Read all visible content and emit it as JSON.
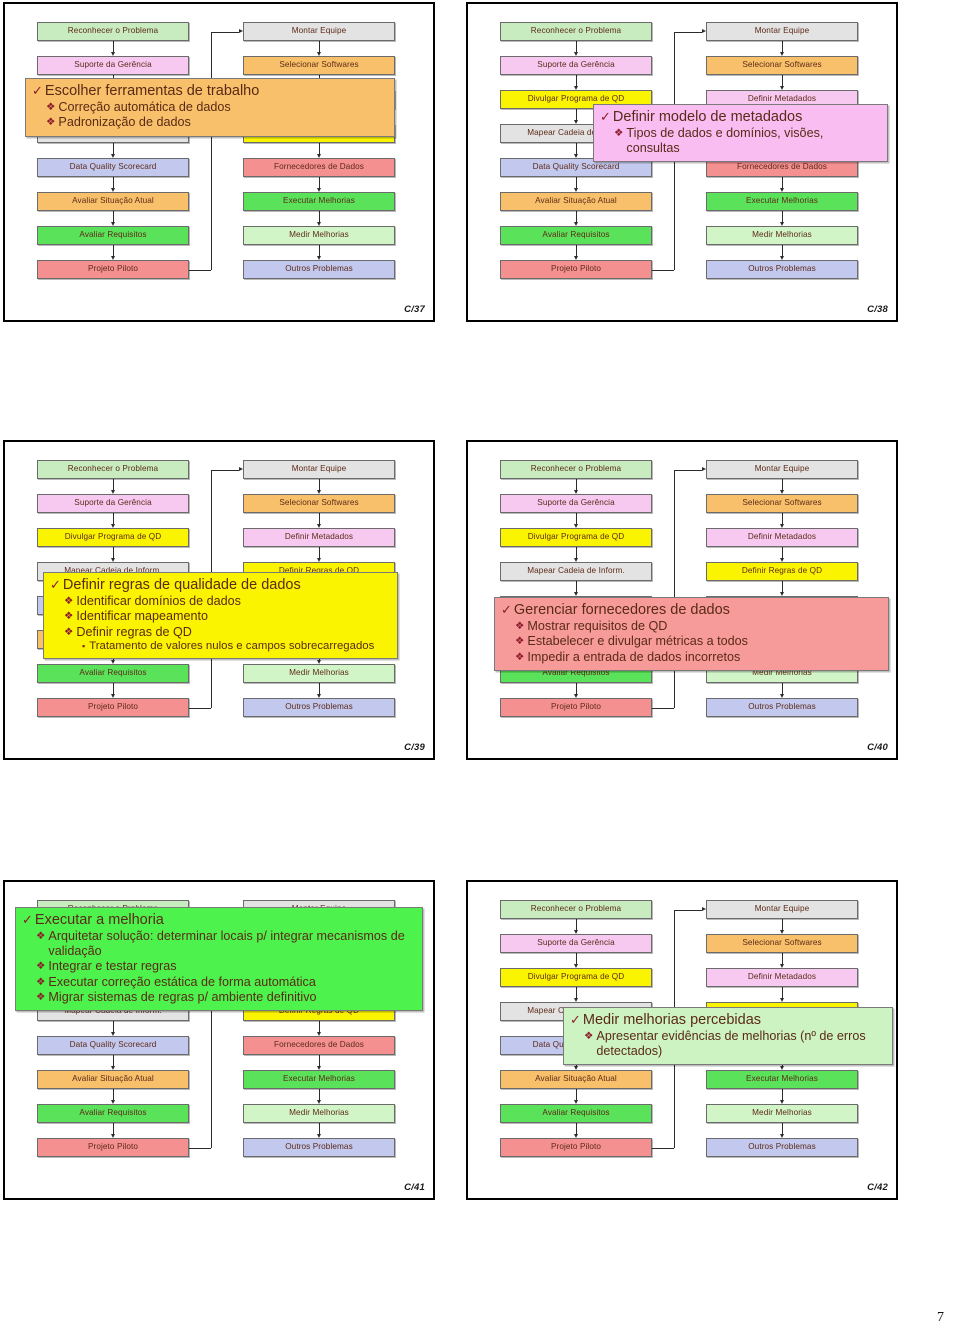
{
  "page": {
    "number": "7"
  },
  "colors": {
    "green_light": "#c8ecc0",
    "pink": "#f7c8f0",
    "yellow": "#fbf400",
    "gray": "#e3e3e3",
    "periwinkle": "#c3c8ee",
    "orange": "#f8c06a",
    "green": "#5ae25a",
    "red": "#f49090",
    "green_pale": "#d2f5c8",
    "text": "#5c2a18",
    "accent": "#8b1c2b",
    "border": "#6b6b6b"
  },
  "flow": {
    "left_column": [
      {
        "label": "Reconhecer o Problema",
        "color": "#c8ecc0"
      },
      {
        "label": "Suporte da Gerência",
        "color": "#f7c8f0"
      },
      {
        "label": "Divulgar Programa de QD",
        "color": "#fbf400"
      },
      {
        "label": "Mapear Cadeia de Inform.",
        "color": "#e3e3e3"
      },
      {
        "label": "Data Quality Scorecard",
        "color": "#c3c8ee"
      },
      {
        "label": "Avaliar Situação Atual",
        "color": "#f8c06a"
      },
      {
        "label": "Avaliar Requisitos",
        "color": "#5ae25a"
      },
      {
        "label": "Projeto Piloto",
        "color": "#f49090"
      }
    ],
    "right_column": [
      {
        "label": "Montar Equipe",
        "color": "#e3e3e3"
      },
      {
        "label": "Selecionar Softwares",
        "color": "#f8c06a"
      },
      {
        "label": "Definir Metadados",
        "color": "#f7c8f0"
      },
      {
        "label": "Definir Regras de QD",
        "color": "#fbf400"
      },
      {
        "label": "Fornecedores de Dados",
        "color": "#f49090"
      },
      {
        "label": "Executar Melhorias",
        "color": "#5ae25a"
      },
      {
        "label": "Medir Melhorias",
        "color": "#d2f5c8"
      },
      {
        "label": "Outros Problemas",
        "color": "#c3c8ee"
      }
    ]
  },
  "slides": [
    {
      "number": "C/37",
      "overlay": {
        "bg": "#f8c06a",
        "title": "Escolher ferramentas de trabalho",
        "bullets": [
          {
            "level": 2,
            "text": "Correção automática de dados"
          },
          {
            "level": 2,
            "text": "Padronização de dados"
          }
        ]
      }
    },
    {
      "number": "C/38",
      "overlay": {
        "bg": "#f9bdf2",
        "title": "Definir modelo de metadados",
        "bullets": [
          {
            "level": 2,
            "text": "Tipos de dados e domínios, visões, consultas"
          }
        ]
      }
    },
    {
      "number": "C/39",
      "overlay": {
        "bg": "#fbf400",
        "title": "Definir regras de qualidade de dados",
        "bullets": [
          {
            "level": 2,
            "text": "Identificar domínios de dados"
          },
          {
            "level": 2,
            "text": "Identificar mapeamento"
          },
          {
            "level": 2,
            "text": "Definir regras de QD"
          },
          {
            "level": 3,
            "text": "Tratamento de valores nulos e campos sobrecarregados"
          }
        ]
      }
    },
    {
      "number": "C/40",
      "overlay": {
        "bg": "#f79a9a",
        "title": "Gerenciar fornecedores de dados",
        "bullets": [
          {
            "level": 2,
            "text": "Mostrar requisitos de QD"
          },
          {
            "level": 2,
            "text": "Estabelecer e divulgar métricas a todos"
          },
          {
            "level": 2,
            "text": "Impedir a entrada de dados incorretos"
          }
        ]
      }
    },
    {
      "number": "C/41",
      "overlay": {
        "bg": "#4df24d",
        "title": "Executar a melhoria",
        "bullets": [
          {
            "level": 2,
            "text": "Arquitetar solução: determinar locais p/ integrar mecanismos de validação"
          },
          {
            "level": 2,
            "text": "Integrar e testar regras"
          },
          {
            "level": 2,
            "text": "Executar correção estática de forma automática"
          },
          {
            "level": 2,
            "text": "Migrar sistemas de regras p/ ambiente definitivo"
          }
        ]
      }
    },
    {
      "number": "C/42",
      "overlay": {
        "bg": "#cdf3c2",
        "title": "Medir melhorias percebidas",
        "bullets": [
          {
            "level": 2,
            "text": "Apresentar evidências de melhorias (nº de erros detectados)"
          }
        ]
      }
    }
  ],
  "icons": {
    "check": "✓",
    "diamond": "❖",
    "square": "▪"
  }
}
